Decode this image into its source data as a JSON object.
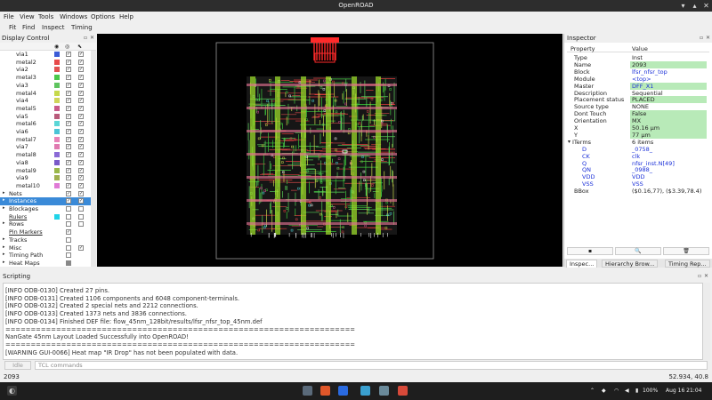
{
  "window": {
    "title": "OpenROAD"
  },
  "menu": [
    "File",
    "View",
    "Tools",
    "Windows",
    "Options",
    "Help"
  ],
  "toolbar": [
    "Fit",
    "Find",
    "Inspect",
    "Timing"
  ],
  "display_control": {
    "title": "Display Control",
    "rows": [
      {
        "label": "via1",
        "color": "#3b5bd6",
        "indent": 1,
        "visible": true,
        "selectable": true
      },
      {
        "label": "metal2",
        "color": "#e84a4a",
        "indent": 1,
        "visible": true,
        "selectable": true
      },
      {
        "label": "via2",
        "color": "#e05252",
        "indent": 1,
        "visible": true,
        "selectable": true
      },
      {
        "label": "metal3",
        "color": "#4ac84a",
        "indent": 1,
        "visible": true,
        "selectable": true
      },
      {
        "label": "via3",
        "color": "#5fc45f",
        "indent": 1,
        "visible": true,
        "selectable": true
      },
      {
        "label": "metal4",
        "color": "#c6d94a",
        "indent": 1,
        "visible": true,
        "selectable": true
      },
      {
        "label": "via4",
        "color": "#cfd55a",
        "indent": 1,
        "visible": true,
        "selectable": true
      },
      {
        "label": "metal5",
        "color": "#c85a8a",
        "indent": 1,
        "visible": true,
        "selectable": true
      },
      {
        "label": "via5",
        "color": "#b85a7a",
        "indent": 1,
        "visible": true,
        "selectable": true
      },
      {
        "label": "metal6",
        "color": "#5ad6d6",
        "indent": 1,
        "visible": true,
        "selectable": true
      },
      {
        "label": "via6",
        "color": "#4ac4d6",
        "indent": 1,
        "visible": true,
        "selectable": true
      },
      {
        "label": "metal7",
        "color": "#e883b8",
        "indent": 1,
        "visible": true,
        "selectable": true
      },
      {
        "label": "via7",
        "color": "#e07ab0",
        "indent": 1,
        "visible": true,
        "selectable": true
      },
      {
        "label": "metal8",
        "color": "#8a6ad6",
        "indent": 1,
        "visible": true,
        "selectable": true
      },
      {
        "label": "via8",
        "color": "#7a5ac8",
        "indent": 1,
        "visible": true,
        "selectable": true
      },
      {
        "label": "metal9",
        "color": "#9ab84a",
        "indent": 1,
        "visible": true,
        "selectable": true
      },
      {
        "label": "via9",
        "color": "#a0b050",
        "indent": 1,
        "visible": true,
        "selectable": true
      },
      {
        "label": "metal10",
        "color": "#e07ad6",
        "indent": 1,
        "visible": true,
        "selectable": true
      },
      {
        "label": "Nets",
        "arrow": "▸",
        "indent": 0,
        "visible": true,
        "selectable": true
      },
      {
        "label": "Instances",
        "arrow": "▸",
        "indent": 0,
        "visible": true,
        "selectable": true,
        "selected": true
      },
      {
        "label": "Blockages",
        "arrow": "▸",
        "indent": 0,
        "visible": false,
        "selectable": false
      },
      {
        "label": "Rulers",
        "color": "#20d4e8",
        "indent": 0,
        "visible": false,
        "selectable": false
      },
      {
        "label": "Rows",
        "arrow": "▸",
        "indent": 0,
        "visible": false,
        "selectable": false
      },
      {
        "label": "Pin Markers",
        "indent": 0,
        "visible": true,
        "selectable": null
      },
      {
        "label": "Tracks",
        "arrow": "▸",
        "indent": 0,
        "visible": false,
        "selectable": null
      },
      {
        "label": "Misc",
        "arrow": "▸",
        "indent": 0,
        "visible": false,
        "selectable": true
      },
      {
        "label": "Timing Path",
        "arrow": "▸",
        "indent": 0,
        "visible": false,
        "selectable": null
      },
      {
        "label": "Heat Maps",
        "arrow": "▸",
        "indent": 0,
        "visible": false,
        "selectable": null
      }
    ]
  },
  "inspector": {
    "title": "Inspector",
    "col_property": "Property",
    "col_value": "Value",
    "rows": [
      {
        "key": "Type",
        "value": "Inst",
        "indent": 1
      },
      {
        "key": "Name",
        "value": "2093",
        "indent": 1,
        "hl": true
      },
      {
        "key": "Block",
        "value": "lfsr_nfsr_top",
        "indent": 1,
        "link": true
      },
      {
        "key": "Module",
        "value": "<top>",
        "indent": 1,
        "link": true
      },
      {
        "key": "Master",
        "value": "DFF_X1",
        "indent": 1,
        "link": true,
        "hl": true
      },
      {
        "key": "Description",
        "value": "Sequential",
        "indent": 1
      },
      {
        "key": "Placement status",
        "value": "PLACED",
        "indent": 1,
        "hl": true
      },
      {
        "key": "Source type",
        "value": "NONE",
        "indent": 1
      },
      {
        "key": "Dont Touch",
        "value": "False",
        "indent": 1,
        "hl": true
      },
      {
        "key": "Orientation",
        "value": "MX",
        "indent": 1,
        "hl": true
      },
      {
        "key": "X",
        "value": "50.16 µm",
        "indent": 1,
        "hl": true
      },
      {
        "key": "Y",
        "value": "77 µm",
        "indent": 1,
        "hl": true
      },
      {
        "key": "ITerms",
        "value": "6 items",
        "indent": 0,
        "arrow": "▾"
      },
      {
        "key": "D",
        "value": "_0758_",
        "indent": 2,
        "link": true,
        "klink": true
      },
      {
        "key": "CK",
        "value": "clk",
        "indent": 2,
        "link": true,
        "klink": true
      },
      {
        "key": "Q",
        "value": "nfsr_inst.N[49]",
        "indent": 2,
        "link": true,
        "klink": true
      },
      {
        "key": "QN",
        "value": "_0988_",
        "indent": 2,
        "link": true,
        "klink": true
      },
      {
        "key": "VDD",
        "value": "VDD",
        "indent": 2,
        "link": true,
        "klink": true
      },
      {
        "key": "VSS",
        "value": "VSS",
        "indent": 2,
        "link": true,
        "klink": true
      },
      {
        "key": "BBox",
        "value": "($0.16,77), ($3.39,78.4)",
        "indent": 1
      }
    ],
    "tabs": [
      "Inspec...",
      "Hierarchy Brow...",
      "Timing Rep..."
    ]
  },
  "scripting": {
    "title": "Scripting",
    "lines": [
      "[INFO ODB-0130]     Created 27 pins.",
      "[INFO ODB-0131]     Created 1106 components and 6048 component-terminals.",
      "[INFO ODB-0132]     Created 2 special nets and 2212 connections.",
      "[INFO ODB-0133]     Created 1373 nets and 3836 connections.",
      "[INFO ODB-0134] Finished DEF file: flow_45nm_128bit/results/lfsr_nfsr_top_45nm.def",
      "=====================================================================",
      "  NanGate 45nm Layout Loaded Successfully into OpenROAD!",
      "=====================================================================",
      "[WARNING GUI-0066] Heat map \"IR Drop\" has not been populated with data."
    ],
    "idle": "Idle",
    "placeholder": "TCL commands"
  },
  "status": {
    "left": "2093",
    "right": "52.934, 40.8"
  },
  "taskbar": {
    "battery": "100%",
    "datetime": "Aug 16  21:04"
  },
  "colors": {
    "selection": "#3a8ad8",
    "highlight": "#b8eab8",
    "link": "#1a2fd8"
  }
}
